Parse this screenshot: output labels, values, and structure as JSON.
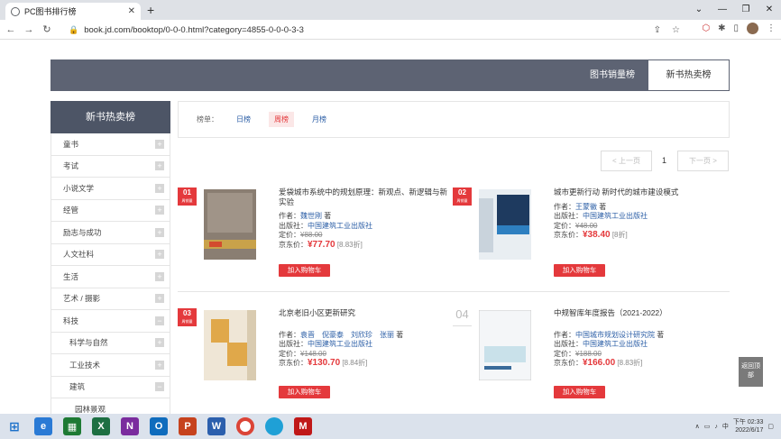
{
  "browser": {
    "tab_title": "PC图书排行榜",
    "tab_close": "✕",
    "new_tab": "+",
    "url": "book.jd.com/booktop/0-0-0.html?category=4855-0-0-0-3-3"
  },
  "topbar": {
    "tab1": "图书销量榜",
    "tab2": "新书热卖榜"
  },
  "sidebar": {
    "title": "新书热卖榜",
    "items": [
      {
        "label": "童书",
        "sign": "+"
      },
      {
        "label": "考试",
        "sign": "+"
      },
      {
        "label": "小说文学",
        "sign": "+"
      },
      {
        "label": "经管",
        "sign": "+"
      },
      {
        "label": "励志与成功",
        "sign": "+"
      },
      {
        "label": "人文社科",
        "sign": "+"
      },
      {
        "label": "生活",
        "sign": "+"
      },
      {
        "label": "艺术 / 摄影",
        "sign": "+"
      },
      {
        "label": "科技",
        "sign": "−"
      },
      {
        "label": "科学与自然",
        "sign": "+"
      },
      {
        "label": "工业技术",
        "sign": "+"
      },
      {
        "label": "建筑",
        "sign": "−"
      },
      {
        "label": "园林景观",
        "sign": ""
      }
    ]
  },
  "filter": {
    "label": "榜单：",
    "options": [
      "日榜",
      "周榜",
      "月榜"
    ],
    "active": "周榜"
  },
  "pager": {
    "prev": "< 上一页",
    "current": "1",
    "next": "下一页 >"
  },
  "books": [
    {
      "rank": "01",
      "rank_sub": "周销量",
      "title": "爱袋城市系统中的规划原理：新观点、新逻辑与新实验",
      "author_label": "作者：",
      "author": "魏世刚",
      "author_suffix": "著",
      "publisher_label": "出版社：",
      "publisher": "中国建筑工业出版社",
      "list_label": "定价：",
      "list_price": "¥88.00",
      "jd_label": "京东价：",
      "jd_price": "¥77.70",
      "discount": "[8.83折]",
      "cart": "加入购物车"
    },
    {
      "rank": "02",
      "rank_sub": "周销量",
      "title": "城市更新行动 新时代的城市建设模式",
      "author_label": "作者：",
      "author": "王蒙徽",
      "author_suffix": "著",
      "publisher_label": "出版社：",
      "publisher": "中国建筑工业出版社",
      "list_label": "定价：",
      "list_price": "¥48.00",
      "jd_label": "京东价：",
      "jd_price": "¥38.40",
      "discount": "[8折]",
      "cart": "加入购物车"
    },
    {
      "rank": "03",
      "rank_sub": "周销量",
      "title": "北京老旧小区更新研究",
      "author_label": "作者：",
      "author": "袁晋　倪豪泰　刘欣珍　张丽",
      "author_suffix": "著",
      "publisher_label": "出版社：",
      "publisher": "中国建筑工业出版社",
      "list_label": "定价：",
      "list_price": "¥148.00",
      "jd_label": "京东价：",
      "jd_price": "¥130.70",
      "discount": "[8.84折]",
      "cart": "加入购物车"
    },
    {
      "rank": "04",
      "rank_sub": "",
      "title": "中规智库年度报告（2021-2022）",
      "author_label": "作者：",
      "author": "中国城市规划设计研究院",
      "author_suffix": "著",
      "publisher_label": "出版社：",
      "publisher": "中国建筑工业出版社",
      "list_label": "定价：",
      "list_price": "¥188.00",
      "jd_label": "京东价：",
      "jd_price": "¥166.00",
      "discount": "[8.83折]",
      "cart": "加入购物车"
    }
  ],
  "back_top": "返回顶部",
  "taskbar": {
    "time": "下午 02:33",
    "date": "2022/6/17"
  },
  "colors": {
    "accent": "#e4393c",
    "bar": "#5d6373",
    "side_head": "#4d5566"
  }
}
